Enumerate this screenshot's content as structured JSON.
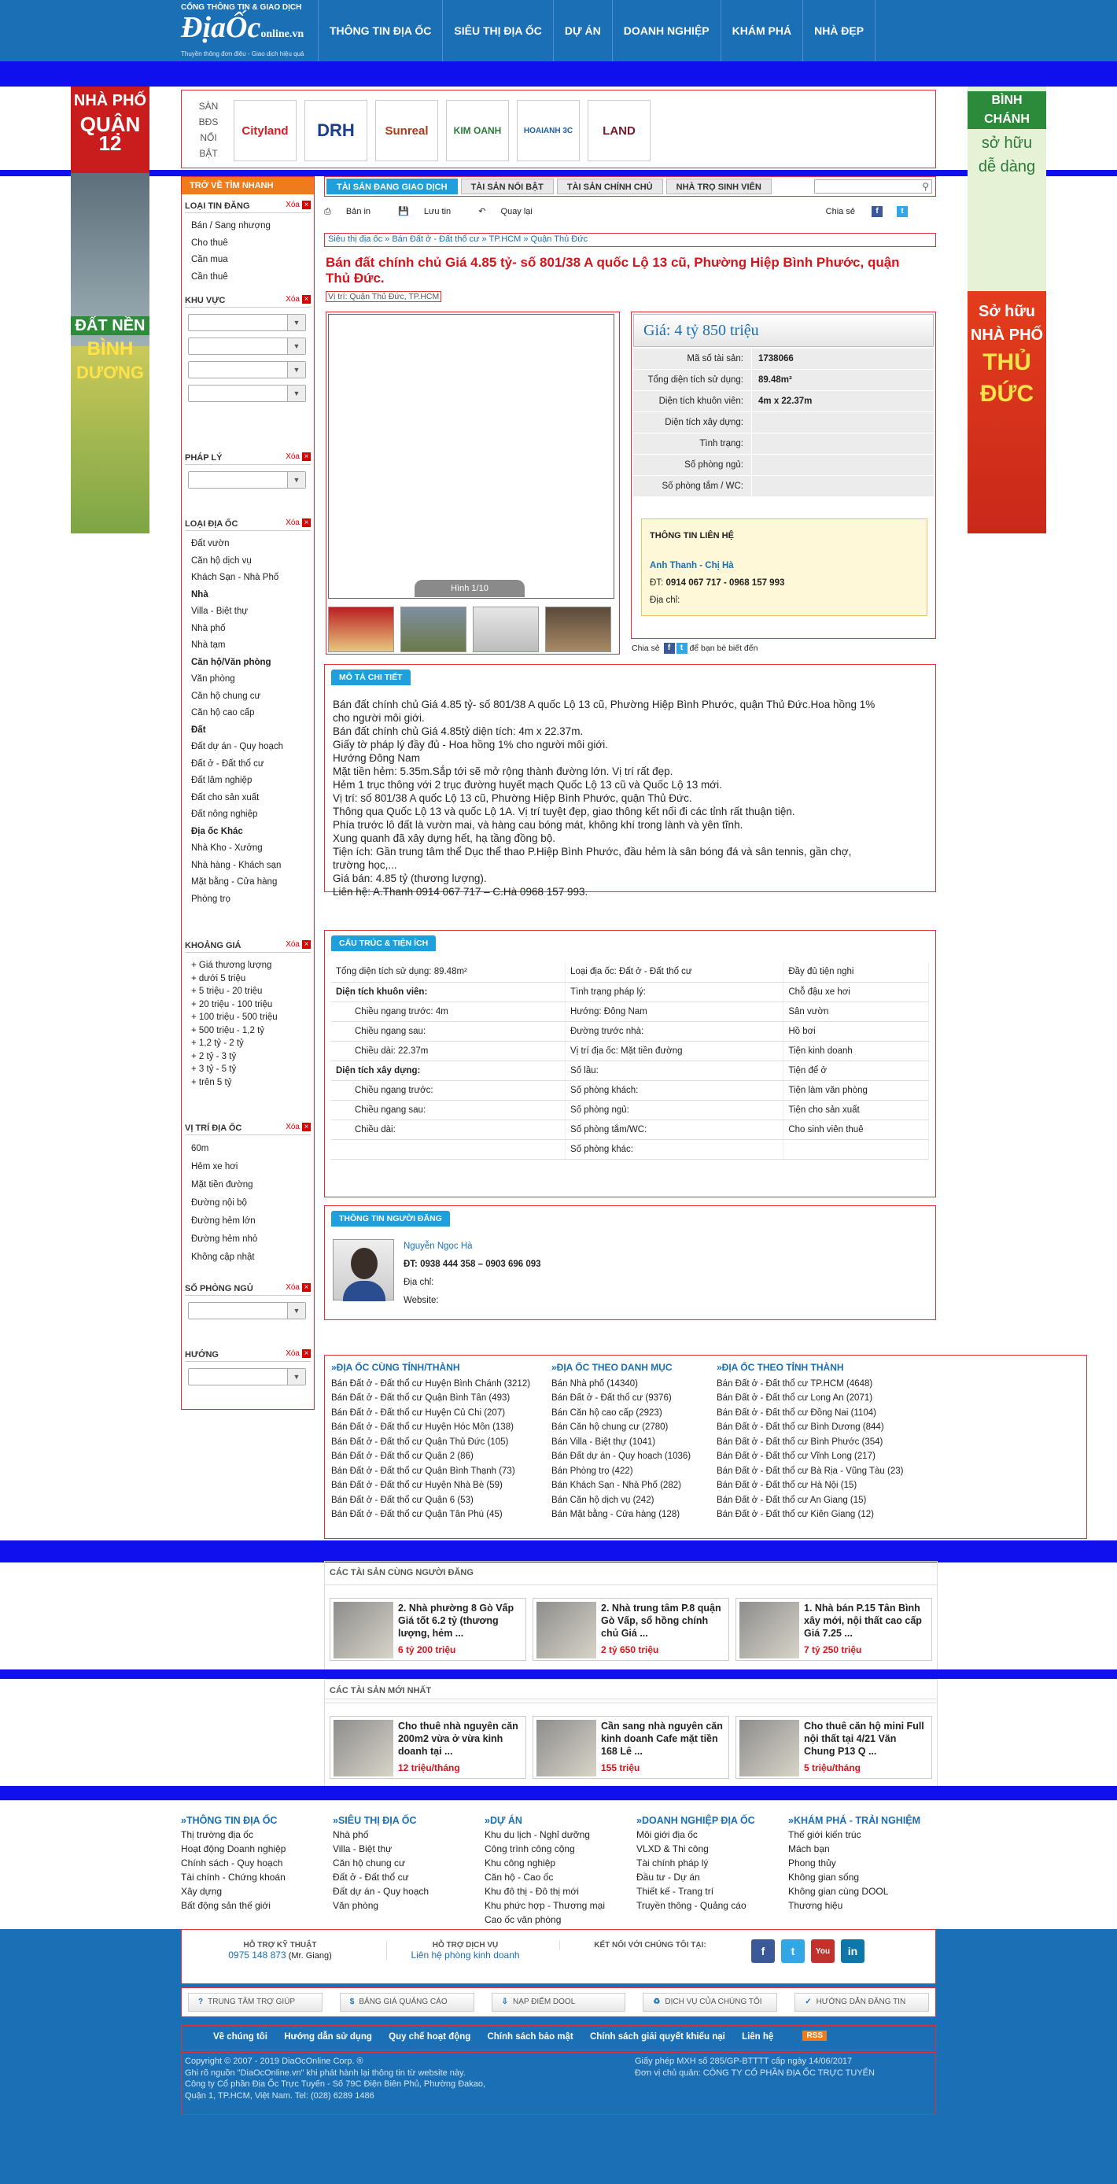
{
  "header": {
    "caption": "CỔNG THÔNG TIN & GIAO DỊCH",
    "brand_main": "ĐịaỐc",
    "brand_online": "online",
    "brand_tld": ".vn",
    "tagline": "Thuyền thông đơn điệu - Giao dịch hiệu quả",
    "nav": [
      "THÔNG TIN ĐỊA ỐC",
      "SIÊU THỊ ĐỊA ỐC",
      "DỰ ÁN",
      "DOANH NGHIỆP",
      "KHÁM PHÁ",
      "NHÀ ĐẸP"
    ]
  },
  "ads": {
    "left_top": [
      "NHÀ PHỐ",
      "QUẬN 12"
    ],
    "left_bottom": [
      "ĐẤT NỀN",
      "BÌNH",
      "DƯƠNG"
    ],
    "right_top": [
      "BÌNH CHÁNH",
      "sở hữu",
      "dễ dàng"
    ],
    "right_bottom": [
      "Sở hữu",
      "NHÀ PHỐ",
      "THỦ",
      "ĐỨC"
    ]
  },
  "brands": {
    "label": "SÀN BĐS NỔI BẬT",
    "logos": [
      "Cityland",
      "DRH",
      "Sunreal",
      "KIM OANH",
      "HOAIANH 3C",
      "LAND"
    ]
  },
  "filters": {
    "header": "TRỞ VỀ TÌM NHANH",
    "xoa": "Xóa",
    "loai_tin": {
      "title": "LOẠI TIN ĐĂNG",
      "items": [
        "Bán / Sang nhượng",
        "Cho thuê",
        "Cần mua",
        "Cần thuê"
      ]
    },
    "khu_vuc": {
      "title": "KHU VỰC"
    },
    "phap_ly": {
      "title": "PHÁP LÝ"
    },
    "loai_dia_oc": {
      "title": "LOẠI ĐỊA ỐC",
      "items": [
        {
          "t": "Đất vườn"
        },
        {
          "t": "Căn hộ dịch vụ"
        },
        {
          "t": "Khách Sạn - Nhà Phố"
        },
        {
          "t": "Nhà",
          "b": true
        },
        {
          "t": "Villa - Biệt thự"
        },
        {
          "t": "Nhà phố"
        },
        {
          "t": "Nhà tạm"
        },
        {
          "t": "Căn hộ/Văn phòng",
          "b": true
        },
        {
          "t": "Văn phòng"
        },
        {
          "t": "Căn hộ chung cư"
        },
        {
          "t": "Căn hộ cao cấp"
        },
        {
          "t": "Đất",
          "b": true
        },
        {
          "t": "Đất dự án - Quy hoạch"
        },
        {
          "t": "Đất ở - Đất thổ cư"
        },
        {
          "t": "Đất lâm nghiệp"
        },
        {
          "t": "Đất cho sản xuất"
        },
        {
          "t": "Đất nông nghiệp"
        },
        {
          "t": "Địa ốc Khác",
          "b": true
        },
        {
          "t": "Nhà Kho - Xưởng"
        },
        {
          "t": "Nhà hàng - Khách sạn"
        },
        {
          "t": "Mặt bằng - Cửa hàng"
        },
        {
          "t": "Phòng trọ"
        }
      ]
    },
    "khoang_gia": {
      "title": "KHOẢNG GIÁ",
      "items": [
        "+ Giá thương lượng",
        "+ dưới 5 triệu",
        "+ 5 triệu - 20 triệu",
        "+ 20 triệu - 100 triệu",
        "+ 100 triệu - 500 triệu",
        "+ 500 triệu - 1,2 tỷ",
        "+ 1,2 tỷ - 2 tỷ",
        "+ 2 tỷ - 3 tỷ",
        "+ 3 tỷ - 5 tỷ",
        "+ trên 5 tỷ"
      ]
    },
    "vi_tri": {
      "title": "VỊ TRÍ ĐỊA ỐC",
      "items": [
        "60m",
        "Hẻm xe hơi",
        "Mặt tiền đường",
        "Đường nội bộ",
        "Đường hẻm lớn",
        "Đường hẻm nhỏ",
        "Không cập nhật"
      ]
    },
    "so_phong_ngu": {
      "title": "SỐ PHÒNG NGỦ"
    },
    "huong": {
      "title": "HƯỚNG"
    }
  },
  "tabs": [
    "TÀI SẢN ĐANG GIAO DỊCH",
    "TÀI SẢN NỔI BẬT",
    "TÀI SẢN CHÍNH CHỦ",
    "NHÀ TRỌ SINH VIÊN"
  ],
  "toolbar": {
    "print": "Bản in",
    "save": "Lưu tin",
    "back": "Quay lại",
    "share": "Chia sẻ"
  },
  "breadcrumb": "Siêu thị địa ốc  »  Bán Đất ở - Đất thổ cư  »  TP.HCM  »  Quận Thủ Đức",
  "listing": {
    "title": "Bán đất chính chủ Giá 4.85 tỷ- số 801/38 A quốc Lộ 13 cũ, Phường Hiệp Bình Phước, quận Thủ Đức.",
    "location": "Vị trí: Quận Thủ Đức, TP.HCM",
    "photo_counter": "Hình 1/10",
    "price": "Giá: 4 tỷ 850 triệu",
    "facts": [
      [
        "Mã số tài sản:",
        "1738066"
      ],
      [
        "Tổng diện tích sử dụng:",
        "89.48m²"
      ],
      [
        "Diện tích khuôn viên:",
        "4m x 22.37m"
      ],
      [
        "Diện tích xây dựng:",
        ""
      ],
      [
        "Tình trạng:",
        ""
      ],
      [
        "Số phòng ngủ:",
        ""
      ],
      [
        "Số phòng tắm / WC:",
        ""
      ]
    ],
    "contact": {
      "title": "THÔNG TIN LIÊN HỆ",
      "name": "Anh Thanh - Chị Hà",
      "phone_label": "ĐT:",
      "phone": "0914 067 717 - 0968 157 993",
      "address": "Địa chỉ:"
    },
    "share_text": "để bạn bè biết đến"
  },
  "description": {
    "title": "MÔ TẢ CHI TIẾT",
    "lines": [
      "Bán đất chính chủ Giá 4.85 tỷ- số 801/38 A quốc Lộ 13 cũ, Phường Hiệp Bình Phước, quận Thủ Đức.Hoa hồng 1%",
      "cho người môi giới.",
      "Bán đất chính chủ Giá 4.85tỷ diện tích: 4m x 22.37m.",
      "Giấy tờ pháp lý đầy đủ - Hoa hồng 1% cho người môi giới.",
      "Hướng Đông Nam",
      "Mặt tiền hẻm: 5.35m.Sắp tới sẽ mở rộng thành đường lớn. Vị trí rất đẹp.",
      "Hẻm 1 trục thông với 2 trục đường huyết mạch Quốc Lộ 13 cũ và Quốc Lộ 13 mới.",
      "Vị trí: số 801/38 A quốc Lộ 13 cũ, Phường Hiệp Bình Phước, quận Thủ Đức.",
      "Thông qua Quốc Lộ 13 và quốc Lộ 1A. Vị trí tuyệt đẹp, giao thông kết nối đi các tỉnh rất thuận tiện.",
      "Phía trước lô đất là vườn mai, và hàng cau bóng mát, không khí trong lành và yên tĩnh.",
      "Xung quanh đã xây dựng hết, hạ tầng đồng bộ.",
      "Tiện ích: Gần trung tâm thể Dục thể thao P.Hiệp Bình Phước, đầu hẻm là sân bóng đá và sân tennis, gần chợ,",
      "trường học,...",
      "Giá bán: 4.85 tỷ (thương lượng).",
      "Liên hệ: A.Thanh 0914 067 717 – C.Hà 0968 157 993."
    ]
  },
  "structure": {
    "title": "CẤU TRÚC & TIỆN ÍCH",
    "rows": [
      [
        {
          "t": "Tổng diện tích sử dụng: 89.48m²",
          "c": ""
        },
        {
          "t": "Loại địa ốc: Đất ở - Đất thổ cư",
          "c": ""
        },
        {
          "t": "Đầy đủ tiện nghi",
          "c": ""
        }
      ],
      [
        {
          "t": "Diện tích khuôn viên:",
          "c": "b"
        },
        {
          "t": "Tình trạng pháp lý:",
          "c": ""
        },
        {
          "t": "Chỗ đậu xe hơi",
          "c": ""
        }
      ],
      [
        {
          "t": "Chiều ngang trước: 4m",
          "c": "ind"
        },
        {
          "t": "Hướng: Đông Nam",
          "c": ""
        },
        {
          "t": "Sân vườn",
          "c": ""
        }
      ],
      [
        {
          "t": "Chiều ngang sau:",
          "c": "ind"
        },
        {
          "t": "Đường trước nhà:",
          "c": ""
        },
        {
          "t": "Hồ bơi",
          "c": ""
        }
      ],
      [
        {
          "t": "Chiều dài: 22.37m",
          "c": "ind"
        },
        {
          "t": "Vị trí địa ốc: Mặt tiền đường",
          "c": ""
        },
        {
          "t": "Tiện kinh doanh",
          "c": ""
        }
      ],
      [
        {
          "t": "Diện tích xây dựng:",
          "c": "b"
        },
        {
          "t": "Số lầu:",
          "c": ""
        },
        {
          "t": "Tiện để ở",
          "c": ""
        }
      ],
      [
        {
          "t": "Chiều ngang trước:",
          "c": "ind"
        },
        {
          "t": "Số phòng khách:",
          "c": ""
        },
        {
          "t": "Tiện làm văn phòng",
          "c": ""
        }
      ],
      [
        {
          "t": "Chiều ngang sau:",
          "c": "ind"
        },
        {
          "t": "Số phòng ngủ:",
          "c": ""
        },
        {
          "t": "Tiện cho sản xuất",
          "c": ""
        }
      ],
      [
        {
          "t": "Chiều dài:",
          "c": "ind"
        },
        {
          "t": "Số phòng tắm/WC:",
          "c": ""
        },
        {
          "t": "Cho sinh viên thuê",
          "c": ""
        }
      ],
      [
        {
          "t": "",
          "c": ""
        },
        {
          "t": "Số phòng khác:",
          "c": ""
        },
        {
          "t": "",
          "c": ""
        }
      ]
    ]
  },
  "seller": {
    "title": "THÔNG TIN NGƯỜI ĐĂNG",
    "name": "Nguyễn Ngọc Hà",
    "phone": "ĐT: 0938 444 358 – 0903 696 093",
    "address": "Địa chỉ:",
    "website": "Website:"
  },
  "related": {
    "col1": {
      "title": "»ĐỊA ỐC CÙNG TỈNH/THÀNH",
      "items": [
        "Bán Đất ở - Đất thổ cư Huyện Bình Chánh (3212)",
        "Bán Đất ở - Đất thổ cư Quận Bình Tân (493)",
        "Bán Đất ở - Đất thổ cư Huyện Củ Chi (207)",
        "Bán Đất ở - Đất thổ cư Huyện Hóc Môn (138)",
        "Bán Đất ở - Đất thổ cư Quận Thủ Đức (105)",
        "Bán Đất ở - Đất thổ cư Quận 2 (86)",
        "Bán Đất ở - Đất thổ cư Quận Bình Thạnh (73)",
        "Bán Đất ở - Đất thổ cư Huyện Nhà Bè (59)",
        "Bán Đất ở - Đất thổ cư Quận 6 (53)",
        "Bán Đất ở - Đất thổ cư Quận Tân Phú (45)"
      ]
    },
    "col2": {
      "title": "»ĐỊA ỐC THEO DANH MỤC",
      "items": [
        "Bán Nhà phố (14340)",
        "Bán Đất ở - Đất thổ cư (9376)",
        "Bán Căn hộ cao cấp (2923)",
        "Bán Căn hộ chung cư (2780)",
        "Bán Villa - Biệt thự (1041)",
        "Bán Đất dự án - Quy hoạch (1036)",
        "Bán Phòng trọ (422)",
        "Bán Khách Sạn - Nhà Phố (282)",
        "Bán Căn hộ dịch vụ (242)",
        "Bán Mặt bằng - Cửa hàng (128)"
      ]
    },
    "col3": {
      "title": "»ĐỊA ỐC THEO TỈNH THÀNH",
      "items": [
        "Bán Đất ở - Đất thổ cư TP.HCM (4648)",
        "Bán Đất ở - Đất thổ cư Long An (2071)",
        "Bán Đất ở - Đất thổ cư Đồng Nai (1104)",
        "Bán Đất ở - Đất thổ cư Bình Dương (844)",
        "Bán Đất ở - Đất thổ cư Bình Phước (354)",
        "Bán Đất ở - Đất thổ cư Vĩnh Long (217)",
        "Bán Đất ở - Đất thổ cư Bà Rịa - Vũng Tàu (23)",
        "Bán Đất ở - Đất thổ cư Hà Nội (15)",
        "Bán Đất ở - Đất thổ cư An Giang (15)",
        "Bán Đất ở - Đất thổ cư Kiên Giang (12)"
      ]
    }
  },
  "same_seller": {
    "title": "CÁC TÀI SẢN CÙNG NGƯỜI ĐĂNG",
    "cards": [
      {
        "title": "2. Nhà phường 8 Gò Vấp Giá tốt 6.2 tỷ (thương lượng, hẻm ...",
        "price": "6 tỷ 200 triệu"
      },
      {
        "title": "2. Nhà trung tâm P.8 quận Gò Vấp, sổ hồng chính chủ Giá ...",
        "price": "2 tỷ 650 triệu"
      },
      {
        "title": "1. Nhà bán P.15 Tân Bình xây mới, nội thất cao cấp Giá 7.25 ...",
        "price": "7 tỷ 250 triệu"
      }
    ]
  },
  "new_items": {
    "title": "CÁC TÀI SẢN MỚI NHẤT",
    "cards": [
      {
        "title": "Cho thuê nhà nguyên căn 200m2 vừa ở vừa kinh doanh tại ...",
        "price": "12 triệu/tháng"
      },
      {
        "title": "Cần sang nhà nguyên căn kinh doanh Cafe mặt tiền 168 Lê ...",
        "price": "155 triệu"
      },
      {
        "title": "Cho thuê căn hộ mini Full nội thất tại 4/21 Văn Chung P13 Q ...",
        "price": "5 triệu/tháng"
      }
    ]
  },
  "footer": {
    "cols": [
      {
        "title": "»THÔNG TIN ĐỊA ỐC",
        "items": [
          "Thị trường địa ốc",
          "Hoạt động Doanh nghiệp",
          "Chính sách - Quy hoạch",
          "Tài chính - Chứng khoán",
          "Xây dựng",
          "Bất động sản thế giới"
        ]
      },
      {
        "title": "»SIÊU THỊ ĐỊA ỐC",
        "items": [
          "Nhà phố",
          "Villa - Biệt thự",
          "Căn hộ chung cư",
          "Đất ở - Đất thổ cư",
          "Đất dự án - Quy hoạch",
          "Văn phòng"
        ]
      },
      {
        "title": "»DỰ ÁN",
        "items": [
          "Khu du lịch - Nghỉ dưỡng",
          "Công trình công cộng",
          "Khu công nghiệp",
          "Căn hộ - Cao ốc",
          "Khu đô thị - Đô thị mới",
          "Khu phức hợp - Thương mại",
          "Cao ốc văn phòng"
        ]
      },
      {
        "title": "»DOANH NGHIỆP ĐỊA ỐC",
        "items": [
          "Môi giới địa ốc",
          "VLXD & Thi công",
          "Tài chính pháp lý",
          "Đầu tư - Dự án",
          "Thiết kế - Trang trí",
          "Truyền thông - Quảng cáo"
        ]
      },
      {
        "title": "»KHÁM PHÁ - TRẢI NGHIỆM",
        "items": [
          "Thế giới kiến trúc",
          "Mách bạn",
          "Phong thủy",
          "Không gian sống",
          "Không gian cùng DOOL",
          "Thương hiệu"
        ]
      }
    ],
    "support": {
      "tech_h": "HỖ TRỢ KỸ THUẬT",
      "tech_phone": "0975 148 873",
      "tech_name": "(Mr. Giang)",
      "svc_h": "HỖ TRỢ DỊCH VỤ",
      "svc_link": "Liên hệ phòng kinh doanh",
      "connect": "KẾT NỐI VỚI CHÚNG TÔI TẠI:"
    },
    "help": [
      "TRUNG TÂM TRỢ GIÚP",
      "BẢNG GIÁ QUẢNG CÁO",
      "NẠP ĐIỂM DOOL",
      "DỊCH VỤ CỦA CHÚNG TÔI",
      "HƯỚNG DẪN ĐĂNG TIN"
    ],
    "legal": [
      "Về chúng tôi",
      "Hướng dẫn sử dụng",
      "Quy chế hoạt động",
      "Chính sách bảo mật",
      "Chính sách giải quyết khiếu nại",
      "Liên hệ"
    ],
    "rss": "RSS",
    "copy_left": [
      "Copyright © 2007 - 2019 DiaOcOnline Corp. ®",
      "Ghi rõ nguồn \"DiaOcOnline.vn\" khi phát hành lại thông tin từ website này.",
      "Công ty Cổ phần Địa Ốc Trực Tuyến - Số 79C Điện Biên Phủ, Phường Đakao,",
      "Quận 1, TP.HCM, Việt Nam. Tel: (028) 6289 1486"
    ],
    "copy_right": [
      "Giấy phép MXH số 285/GP-BTTTT cấp ngày 14/06/2017",
      "Đơn vị chủ quản: CÔNG TY CỔ PHẦN ĐỊA ỐC TRỰC TUYẾN"
    ]
  }
}
